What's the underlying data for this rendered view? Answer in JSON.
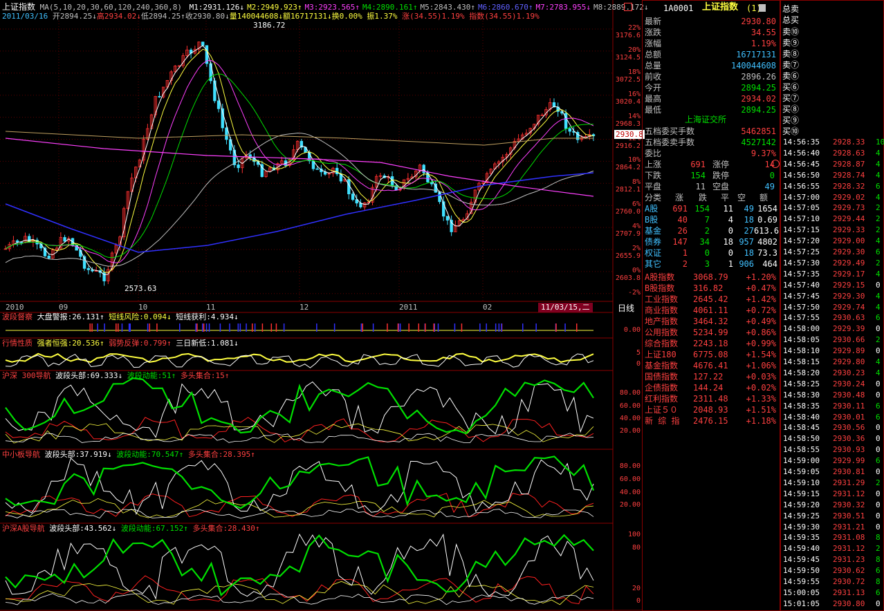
{
  "chart_title": "上证指数",
  "ma_params": "MA(5,10,20,30,60,120,240,360,8)",
  "ma_values": [
    {
      "label": "M1:2931.126↓",
      "color": "#ffffff"
    },
    {
      "label": "M2:2949.923↑",
      "color": "#ffff40"
    },
    {
      "label": "M3:2923.565↑",
      "color": "#ff40ff"
    },
    {
      "label": "M4:2890.161↑",
      "color": "#00e000"
    },
    {
      "label": "M5:2843.430↑",
      "color": "#c0c0c0"
    },
    {
      "label": "M6:2860.670↑",
      "color": "#6060ff"
    },
    {
      "label": "M7:2783.955↓",
      "color": "#ff40ff"
    },
    {
      "label": "M8:2889.172↓",
      "color": "#c0c0c0"
    }
  ],
  "ohlc_line": {
    "date": "2011/03/16",
    "open": "开2894.25↓",
    "high": "高2934.02↓",
    "low": "低2894.25↑",
    "close": "收2930.80↓",
    "vol": "量140044608↓",
    "amount": "额16717131↓",
    "turnover": "换0.00%",
    "amplitude": "振1.37%",
    "change": "涨(34.55)1.19%",
    "index": "指数(34.55)1.19%"
  },
  "annotations": {
    "high": "3186.72",
    "low": "2573.63"
  },
  "price_axis": [
    {
      "pct": "22%",
      "price": "3176.6"
    },
    {
      "pct": "20%",
      "price": "3124.5"
    },
    {
      "pct": "18%",
      "price": "3072.5"
    },
    {
      "pct": "16%",
      "price": "3020.4"
    },
    {
      "pct": "14%",
      "price": "2968.3"
    },
    {
      "pct": "12%",
      "price": "2916.2"
    },
    {
      "pct": "10%",
      "price": "2864.2"
    },
    {
      "pct": "8%",
      "price": "2812.1"
    },
    {
      "pct": "6%",
      "price": "2760.0"
    },
    {
      "pct": "4%",
      "price": "2707.9"
    },
    {
      "pct": "2%",
      "price": "2655.9"
    },
    {
      "pct": "0%",
      "price": "2603.8"
    },
    {
      "pct": "-2%",
      "price": ""
    }
  ],
  "current_price_tag": "2930.8",
  "time_axis": [
    "2010",
    "09",
    "10",
    "11",
    "12",
    "2011",
    "02"
  ],
  "cursor_date": "11/03/15,二",
  "period": "日线",
  "ind1": {
    "name": "波段督察",
    "l1": "大盘警报:26.131↑",
    "l2": "短线风险:0.094↓",
    "l3": "短线获利:4.934↓",
    "axis": [
      "0.00"
    ]
  },
  "ind2": {
    "name": "行情性质",
    "l1": "强者恒强:20.536↑",
    "l2": "弱势反弹:0.799↑",
    "l3": "三日新低:1.081↓",
    "axis": [
      "5",
      "0"
    ]
  },
  "ind3": {
    "name": "沪深 300导航",
    "l1": "波段头部:69.333↓",
    "l2": "波段动能:51↑",
    "l3": "多头集合:15↑",
    "axis": [
      "80.00",
      "60.00",
      "40.00",
      "20.00"
    ]
  },
  "ind4": {
    "name": "中小板导航",
    "l1": "波段头部:37.919↓",
    "l2": "波段动能:70.547↑",
    "l3": "多头集合:28.395↑",
    "axis": [
      "80.00",
      "60.00",
      "40.00",
      "20.00"
    ]
  },
  "ind5": {
    "name": "沪深A股导航",
    "l1": "波段头部:43.562↓",
    "l2": "波段动能:67.152↑",
    "l3": "多头集合:28.430↑",
    "axis": [
      "100",
      "80",
      "20",
      "0"
    ]
  },
  "quote": {
    "code": "1A0001",
    "name": "上证指数",
    "count": "(1)",
    "rows": [
      {
        "k": "最新",
        "v": "2930.80",
        "c": "#ff4040"
      },
      {
        "k": "涨跌",
        "v": "34.55",
        "c": "#ff4040"
      },
      {
        "k": "涨幅",
        "v": "1.19%",
        "c": "#ff4040"
      },
      {
        "k": "总额",
        "v": "16717131",
        "c": "#40c0ff"
      },
      {
        "k": "总量",
        "v": "140044608",
        "c": "#40c0ff"
      },
      {
        "k": "前收",
        "v": "2896.26",
        "c": "#c0c0c0"
      },
      {
        "k": "今开",
        "v": "2894.25",
        "c": "#00e000"
      },
      {
        "k": "最高",
        "v": "2934.02",
        "c": "#ff4040"
      },
      {
        "k": "最低",
        "v": "2894.25",
        "c": "#00e000"
      }
    ],
    "exchange": "上海证交所",
    "depth": [
      {
        "k": "五档委买手数",
        "v": "5462851",
        "c": "#ff4040"
      },
      {
        "k": "五档委卖手数",
        "v": "4527142",
        "c": "#00e000"
      },
      {
        "k": "委比",
        "v": "9.37%",
        "c": "#ff4040"
      }
    ],
    "adv": [
      {
        "k1": "上涨",
        "v1": "691",
        "k2": "涨停",
        "v2": "14"
      },
      {
        "k1": "下跌",
        "v1": "154",
        "k2": "跌停",
        "v2": "0"
      },
      {
        "k1": "平盘",
        "v1": "11",
        "k2": "空盘",
        "v2": "49"
      }
    ],
    "cat_head": [
      "分类",
      "涨",
      "跌",
      "平",
      "空",
      "额"
    ],
    "cats": [
      {
        "n": "A股",
        "u": "691",
        "d": "154",
        "f": "11",
        "e": "49",
        "a": "1654"
      },
      {
        "n": "B股",
        "u": "40",
        "d": "7",
        "f": "4",
        "e": "18",
        "a": "0.69"
      },
      {
        "n": "基金",
        "u": "26",
        "d": "2",
        "f": "0",
        "e": "27",
        "a": "613.6"
      },
      {
        "n": "债券",
        "u": "147",
        "d": "34",
        "f": "18",
        "e": "957",
        "a": "4802"
      },
      {
        "n": "权证",
        "u": "1",
        "d": "0",
        "f": "0",
        "e": "18",
        "a": "73.3"
      },
      {
        "n": "其它",
        "u": "2",
        "d": "3",
        "f": "1",
        "e": "906",
        "a": "464"
      }
    ],
    "indices": [
      {
        "n": "A股指数",
        "v": "3068.79",
        "p": "+1.20%"
      },
      {
        "n": "B股指数",
        "v": "316.82",
        "p": "+0.47%"
      },
      {
        "n": "工业指数",
        "v": "2645.42",
        "p": "+1.42%"
      },
      {
        "n": "商业指数",
        "v": "4061.11",
        "p": "+0.72%"
      },
      {
        "n": "地产指数",
        "v": "3464.32",
        "p": "+0.49%"
      },
      {
        "n": "公用指数",
        "v": "5234.99",
        "p": "+0.86%"
      },
      {
        "n": "综合指数",
        "v": "2243.18",
        "p": "+0.99%"
      },
      {
        "n": "上证180",
        "v": "6775.08",
        "p": "+1.54%"
      },
      {
        "n": "基金指数",
        "v": "4676.41",
        "p": "+1.06%"
      },
      {
        "n": "国债指数",
        "v": "127.22",
        "p": "+0.03%"
      },
      {
        "n": "企债指数",
        "v": "144.24",
        "p": "+0.02%"
      },
      {
        "n": "红利指数",
        "v": "2311.48",
        "p": "+1.33%"
      },
      {
        "n": "上证５０",
        "v": "2048.93",
        "p": "+1.51%"
      },
      {
        "n": "新 综 指",
        "v": "2476.15",
        "p": "+1.18%"
      }
    ]
  },
  "orderbook": {
    "total_sell": "总卖",
    "total_buy": "总买",
    "sells": [
      "卖⑩",
      "卖⑨",
      "卖⑧",
      "卖⑦",
      "卖⑥"
    ],
    "buys": [
      "买⑥",
      "买⑦",
      "买⑧",
      "买⑨",
      "买⑩"
    ]
  },
  "ticks": [
    {
      "t": "14:56:35",
      "p": "2928.33",
      "a": "10"
    },
    {
      "t": "14:56:40",
      "p": "2928.63",
      "a": "4"
    },
    {
      "t": "14:56:45",
      "p": "2928.87",
      "a": "4"
    },
    {
      "t": "14:56:50",
      "p": "2928.74",
      "a": "4"
    },
    {
      "t": "14:56:55",
      "p": "2928.32",
      "a": "6"
    },
    {
      "t": "14:57:00",
      "p": "2929.02",
      "a": "4"
    },
    {
      "t": "14:57:05",
      "p": "2929.73",
      "a": "2"
    },
    {
      "t": "14:57:10",
      "p": "2929.44",
      "a": "2"
    },
    {
      "t": "14:57:15",
      "p": "2929.33",
      "a": "2"
    },
    {
      "t": "14:57:20",
      "p": "2929.00",
      "a": "4"
    },
    {
      "t": "14:57:25",
      "p": "2929.30",
      "a": "6"
    },
    {
      "t": "14:57:30",
      "p": "2929.49",
      "a": "2"
    },
    {
      "t": "14:57:35",
      "p": "2929.17",
      "a": "4"
    },
    {
      "t": "14:57:40",
      "p": "2929.15",
      "a": "0"
    },
    {
      "t": "14:57:45",
      "p": "2929.30",
      "a": "4"
    },
    {
      "t": "14:57:50",
      "p": "2929.74",
      "a": "4"
    },
    {
      "t": "14:57:55",
      "p": "2930.63",
      "a": "6"
    },
    {
      "t": "14:58:00",
      "p": "2929.39",
      "a": "0"
    },
    {
      "t": "14:58:05",
      "p": "2930.66",
      "a": "2"
    },
    {
      "t": "14:58:10",
      "p": "2929.89",
      "a": "0"
    },
    {
      "t": "14:58:15",
      "p": "2929.80",
      "a": "4"
    },
    {
      "t": "14:58:20",
      "p": "2930.23",
      "a": "4"
    },
    {
      "t": "14:58:25",
      "p": "2930.24",
      "a": "0"
    },
    {
      "t": "14:58:30",
      "p": "2930.48",
      "a": "0"
    },
    {
      "t": "14:58:35",
      "p": "2930.11",
      "a": "6"
    },
    {
      "t": "14:58:40",
      "p": "2930.01",
      "a": "6"
    },
    {
      "t": "14:58:45",
      "p": "2930.56",
      "a": "0"
    },
    {
      "t": "14:58:50",
      "p": "2930.36",
      "a": "0"
    },
    {
      "t": "14:58:55",
      "p": "2930.93",
      "a": "0"
    },
    {
      "t": "14:59:00",
      "p": "2929.99",
      "a": "6"
    },
    {
      "t": "14:59:05",
      "p": "2930.81",
      "a": "0"
    },
    {
      "t": "14:59:10",
      "p": "2931.29",
      "a": "2"
    },
    {
      "t": "14:59:15",
      "p": "2931.12",
      "a": "0"
    },
    {
      "t": "14:59:20",
      "p": "2930.32",
      "a": "0"
    },
    {
      "t": "14:59:25",
      "p": "2930.51",
      "a": "0"
    },
    {
      "t": "14:59:30",
      "p": "2931.21",
      "a": "0"
    },
    {
      "t": "14:59:35",
      "p": "2931.08",
      "a": "8"
    },
    {
      "t": "14:59:40",
      "p": "2931.12",
      "a": "2"
    },
    {
      "t": "14:59:45",
      "p": "2931.23",
      "a": "8"
    },
    {
      "t": "14:59:50",
      "p": "2930.62",
      "a": "6"
    },
    {
      "t": "14:59:55",
      "p": "2930.72",
      "a": "8"
    },
    {
      "t": "15:00:05",
      "p": "2931.13",
      "a": "6"
    },
    {
      "t": "15:01:05",
      "p": "2930.80",
      "a": "0"
    }
  ]
}
